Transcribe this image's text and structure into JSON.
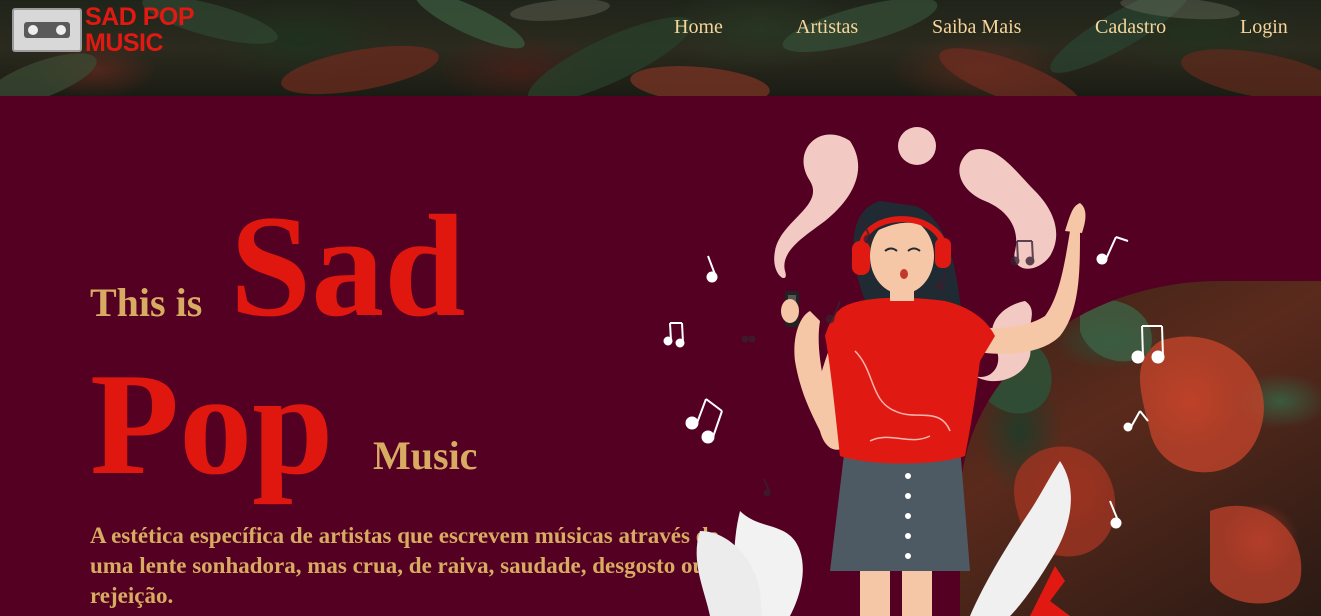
{
  "header": {
    "logo_text_line1": "SAD POP",
    "logo_text_line2": "MUSIC"
  },
  "nav": {
    "items": [
      {
        "label": "Home"
      },
      {
        "label": "Artistas"
      },
      {
        "label": "Saiba Mais"
      },
      {
        "label": "Cadastro"
      },
      {
        "label": "Login"
      }
    ]
  },
  "hero": {
    "title_this_is": "This is",
    "title_sad": "Sad",
    "title_pop": "Pop",
    "title_music": "Music",
    "description": "A estética específica de artistas que escrevem músicas através de uma lente sonhadora, mas crua, de raiva, saudade, desgosto ou rejeição."
  },
  "colors": {
    "background": "#530022",
    "accent_red": "#e0170f",
    "gold": "#d7ab62",
    "nav_text": "#f6d49a"
  },
  "icons": [
    "cassette-logo-icon",
    "music-note-icon",
    "headphones-icon",
    "smartphone-icon"
  ]
}
